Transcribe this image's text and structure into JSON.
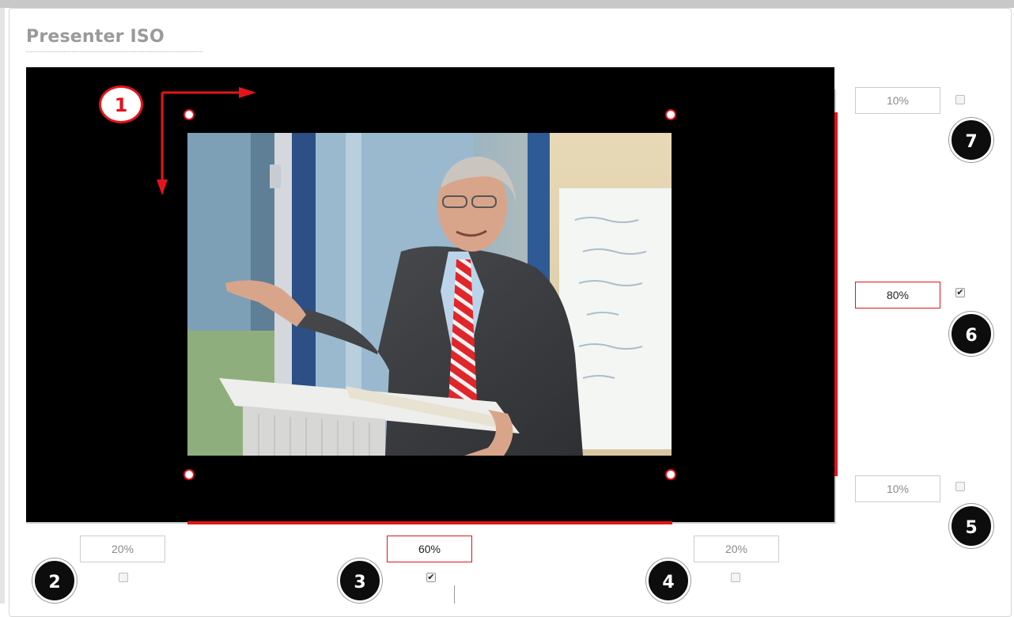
{
  "panel": {
    "title": "Presenter ISO"
  },
  "callout_1": "1",
  "right": {
    "top": {
      "value": "10%",
      "checked": false,
      "badge": "7"
    },
    "middle": {
      "value": "80%",
      "checked": true,
      "badge": "6"
    },
    "bottom": {
      "value": "10%",
      "checked": false,
      "badge": "5"
    }
  },
  "bottom": {
    "left": {
      "value": "20%",
      "checked": false,
      "badge": "2"
    },
    "center": {
      "value": "60%",
      "checked": true,
      "badge": "3"
    },
    "right": {
      "value": "20%",
      "checked": false,
      "badge": "4"
    }
  },
  "colors": {
    "accent": "#e3141b",
    "stage": "#000000",
    "title": "#9a9a9a"
  }
}
